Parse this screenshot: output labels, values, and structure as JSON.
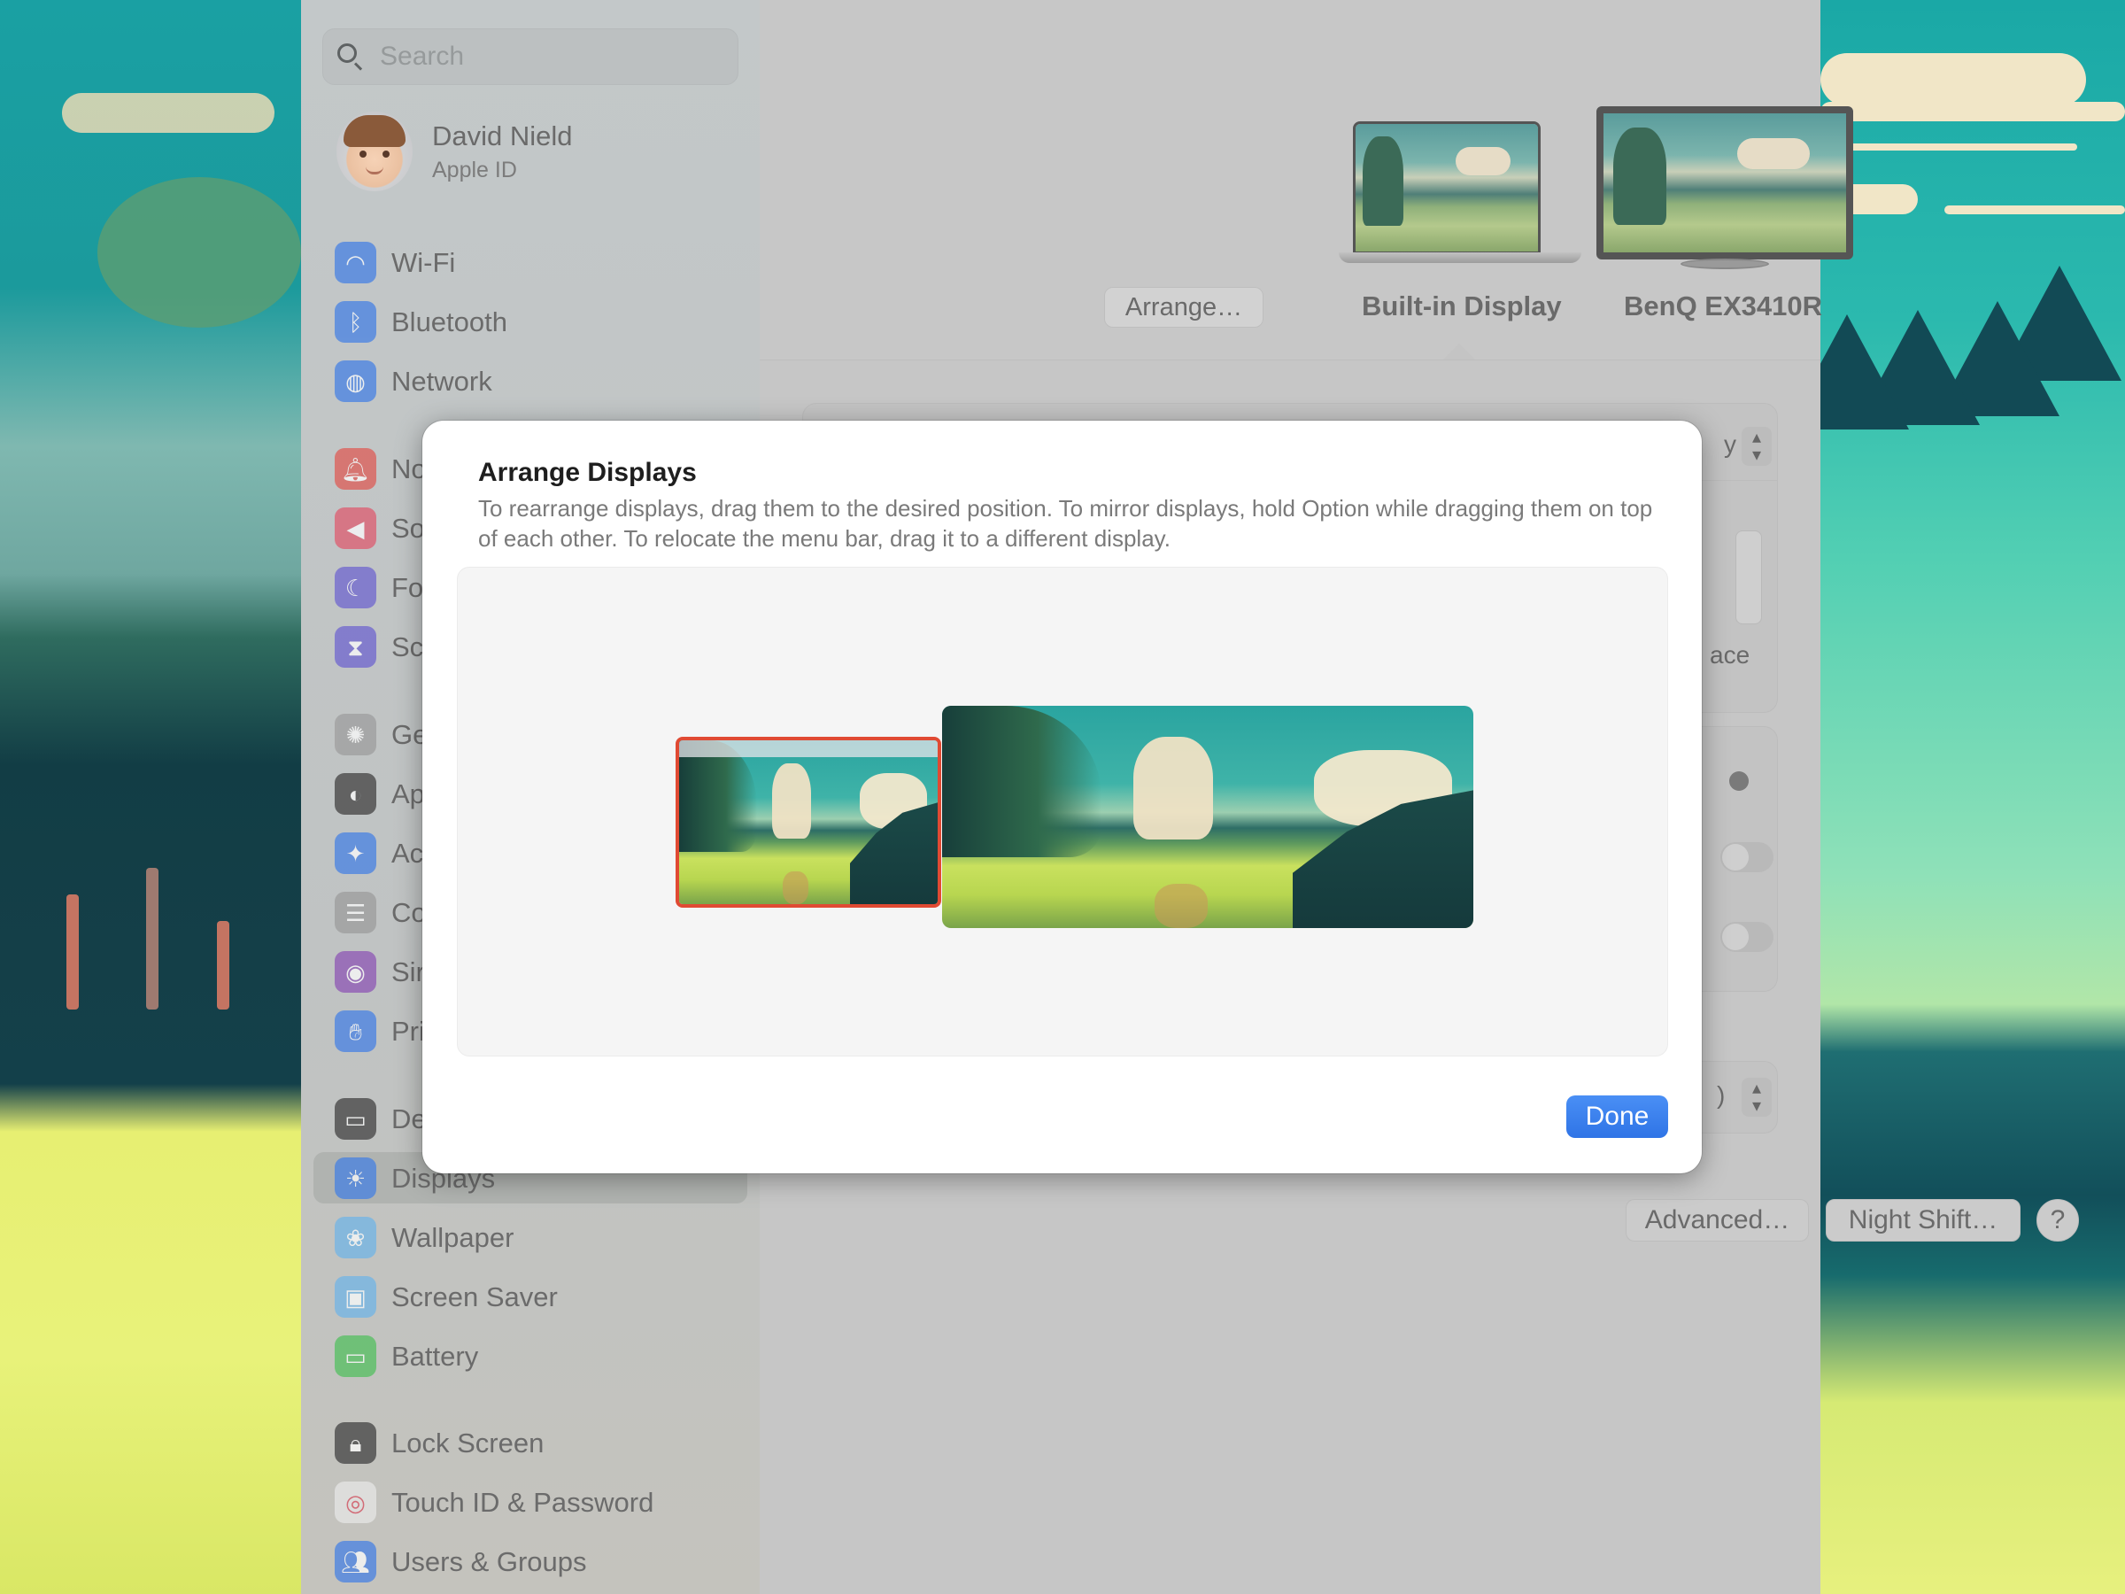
{
  "sidebar": {
    "search_placeholder": "Search",
    "profile": {
      "name": "David Nield",
      "subtitle": "Apple ID"
    },
    "items": [
      {
        "label": "Wi-Fi",
        "icon": "wifi-icon",
        "color": "#3f7de6"
      },
      {
        "label": "Bluetooth",
        "icon": "bluetooth-icon",
        "color": "#3f7de6"
      },
      {
        "label": "Network",
        "icon": "globe-icon",
        "color": "#3f7de6"
      },
      {
        "label": "Notifications",
        "icon": "bell-icon",
        "color": "#e0554f"
      },
      {
        "label": "Sound",
        "icon": "speaker-icon",
        "color": "#e0556a"
      },
      {
        "label": "Focus",
        "icon": "moon-icon",
        "color": "#6a5fd0"
      },
      {
        "label": "Screen Time",
        "icon": "hourglass-icon",
        "color": "#6a5fd0"
      },
      {
        "label": "General",
        "icon": "gear-icon",
        "color": "#9c9c9c"
      },
      {
        "label": "Appearance",
        "icon": "appearance-icon",
        "color": "#3a3a3a"
      },
      {
        "label": "Accessibility",
        "icon": "accessibility-icon",
        "color": "#3f7de6"
      },
      {
        "label": "Control Center",
        "icon": "control-center-icon",
        "color": "#9a9a9a"
      },
      {
        "label": "Siri",
        "icon": "siri-icon",
        "color": "#8a4fb4"
      },
      {
        "label": "Privacy & Security",
        "icon": "hand-icon",
        "color": "#3f7de6"
      },
      {
        "label": "Desktop & Dock",
        "icon": "dock-icon",
        "color": "#3a3a3a"
      },
      {
        "label": "Displays",
        "icon": "sun-icon",
        "color": "#3f7de6",
        "active": true
      },
      {
        "label": "Wallpaper",
        "icon": "flower-icon",
        "color": "#6cb4e8"
      },
      {
        "label": "Screen Saver",
        "icon": "screen-saver-icon",
        "color": "#6cb4e8"
      },
      {
        "label": "Battery",
        "icon": "battery-icon",
        "color": "#4cc05a"
      },
      {
        "label": "Lock Screen",
        "icon": "lock-icon",
        "color": "#3a3a3a"
      },
      {
        "label": "Touch ID & Password",
        "icon": "fingerprint-icon",
        "color": "#e8e8e8"
      },
      {
        "label": "Users & Groups",
        "icon": "users-icon",
        "color": "#3f7de6"
      }
    ]
  },
  "main": {
    "arrange_button": "Arrange…",
    "displays": [
      {
        "label": "Built-in Display",
        "selected": true
      },
      {
        "label": "BenQ EX3410R",
        "selected": false
      }
    ],
    "peek": {
      "select_suffix": "y",
      "section_suffix": "ace",
      "value_suffix": ")"
    },
    "advanced_button": "Advanced…",
    "night_shift_button": "Night Shift…",
    "help_button": "?"
  },
  "dialog": {
    "title": "Arrange Displays",
    "description": "To rearrange displays, drag them to the desired position. To mirror displays, hold Option while dragging them on top of each other. To relocate the menu bar, drag it to a different display.",
    "displays": [
      {
        "name": "Built-in Display",
        "selected": true,
        "has_menu_bar": true
      },
      {
        "name": "BenQ EX3410R",
        "selected": false,
        "has_menu_bar": false
      }
    ],
    "done_button": "Done",
    "accent": "#2f74e6",
    "selection_color": "#e04a33"
  }
}
